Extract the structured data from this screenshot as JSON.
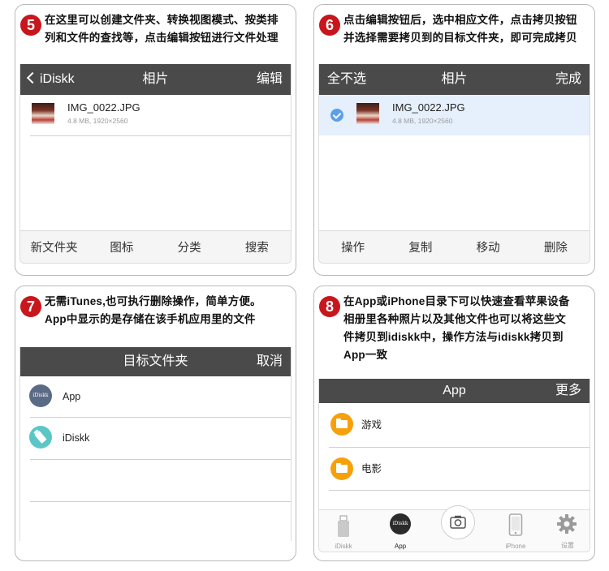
{
  "panels": [
    {
      "step": "5",
      "desc": [
        "在这里可以创建文件夹、转换视图模式、按类排",
        "列和文件的查找等，点击编辑按钮进行文件处理"
      ],
      "nav": {
        "back": "iDiskk",
        "title": "相片",
        "right": "编辑"
      },
      "file": {
        "name": "IMG_0022.JPG",
        "meta": "4.8 MB, 1920×2560"
      },
      "toolbar": [
        "新文件夹",
        "图标",
        "分类",
        "搜索"
      ]
    },
    {
      "step": "6",
      "desc": [
        "点击编辑按钮后，选中相应文件，点击拷贝按钮",
        "并选择需要拷贝到的目标文件夹，即可完成拷贝"
      ],
      "nav": {
        "left": "全不选",
        "title": "相片",
        "right": "完成"
      },
      "file": {
        "name": "IMG_0022.JPG",
        "meta": "4.8 MB, 1920×2560"
      },
      "toolbar": [
        "操作",
        "复制",
        "移动",
        "删除"
      ]
    },
    {
      "step": "7",
      "desc": [
        "无需iTunes,也可执行删除操作，简单方便。",
        "App中显示的是存储在该手机应用里的文件"
      ],
      "nav": {
        "title": "目标文件夹",
        "right": "取消"
      },
      "dirs": [
        {
          "label": "App",
          "icon_text": "iDiskk"
        },
        {
          "label": "iDiskk"
        }
      ]
    },
    {
      "step": "8",
      "desc": [
        "在App或iPhone目录下可以快速查看苹果设备",
        "相册里各种照片以及其他文件也可以将这些文",
        "件拷贝到idiskk中，操作方法与idiskk拷贝到",
        "App一致"
      ],
      "nav": {
        "title": "App",
        "right": "更多"
      },
      "folders": [
        "游戏",
        "电影"
      ],
      "tabs": [
        {
          "label": "iDiskk"
        },
        {
          "label": "App",
          "icon_text": "iDiskk"
        },
        {
          "label": ""
        },
        {
          "label": "iPhone"
        },
        {
          "label": "设置"
        }
      ]
    }
  ],
  "colors": {
    "step_badge": "#c8161d",
    "navbar": "#4a4a4a",
    "selected_row": "#e6f0fc",
    "folder": "#f6a10b",
    "check": "#5aa0e8"
  }
}
